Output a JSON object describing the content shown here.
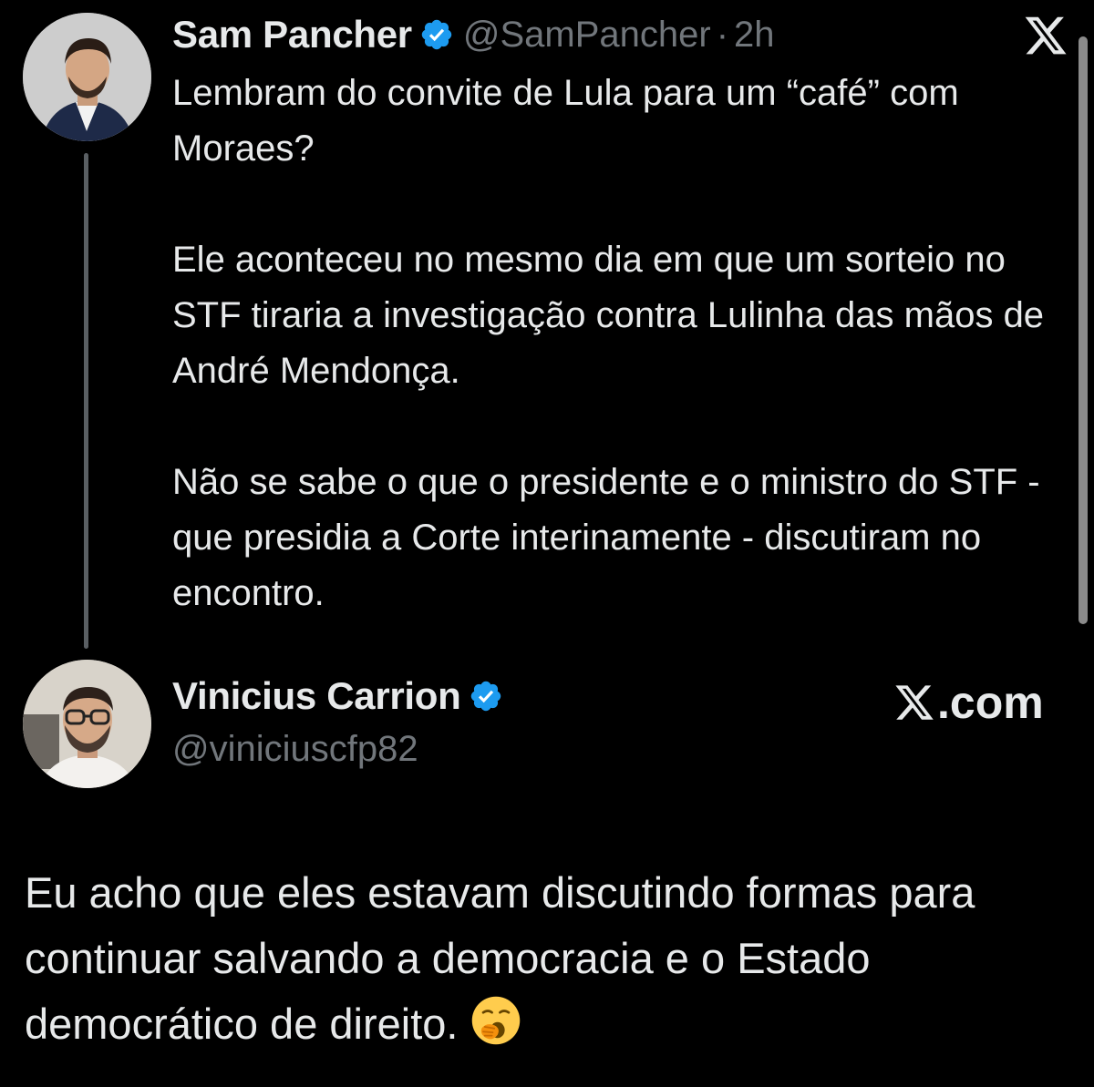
{
  "quoted_tweet": {
    "author_name": "Sam Pancher",
    "verified": true,
    "handle": "@SamPancher",
    "separator": "·",
    "time": "2h",
    "paragraphs": [
      "Lembram do convite de Lula para um “café” com Moraes?",
      "Ele aconteceu no mesmo dia em que um sorteio no STF tiraria a investigação contra Lulinha das mãos de André Mendonça.",
      "Não se sabe o que o presidente e o ministro do STF - que presidia a Corte interinamente - discutiram no encontro."
    ]
  },
  "reply_tweet": {
    "author_name": "Vinicius Carrion",
    "verified": true,
    "handle": "@viniciuscfp82",
    "source_label": ".com",
    "text": "Eu acho que eles estavam discutindo formas para continuar salvando a democracia e o Estado democrático de direito.",
    "emoji": "yawning-face"
  },
  "colors": {
    "background": "#000000",
    "text": "#e7e9ea",
    "muted": "#71767b",
    "verified_badge": "#1d9bf0",
    "thread_line": "#5a5f63"
  },
  "icons": {
    "top_right": "x-logo-icon",
    "badge": "verified-badge-icon"
  }
}
